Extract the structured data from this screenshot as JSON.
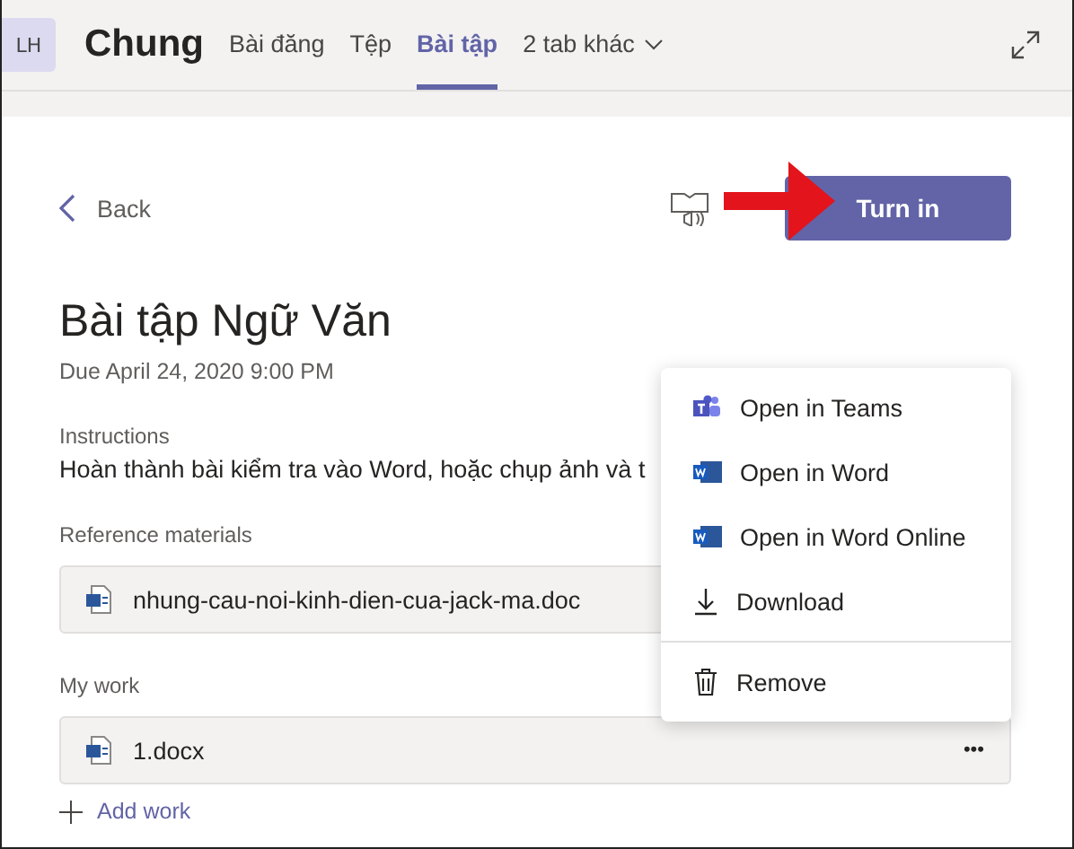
{
  "header": {
    "avatar": "LH",
    "title": "Chung",
    "tabs": [
      {
        "label": "Bài đăng",
        "selected": false,
        "kind": "tab"
      },
      {
        "label": "Tệp",
        "selected": false,
        "kind": "tab"
      },
      {
        "label": "Bài tập",
        "selected": true,
        "kind": "tab"
      },
      {
        "label": "2 tab khác",
        "selected": false,
        "kind": "more"
      }
    ]
  },
  "back": "Back",
  "turn_in": "Turn in",
  "assignment": {
    "title": "Bài tập Ngữ Văn",
    "due": "Due April 24, 2020 9:00 PM",
    "instructions_label": "Instructions",
    "instructions": "Hoàn thành bài kiểm tra vào Word, hoặc chụp ảnh và t",
    "reference_label": "Reference materials",
    "reference_files": [
      "nhung-cau-noi-kinh-dien-cua-jack-ma.doc"
    ],
    "my_work_label": "My work",
    "my_work_files": [
      "1.docx"
    ],
    "more": "•••",
    "add_work": "Add work"
  },
  "menu": [
    {
      "kind": "teams",
      "label": "Open in Teams"
    },
    {
      "kind": "word",
      "label": "Open in Word"
    },
    {
      "kind": "word",
      "label": "Open in Word Online"
    },
    {
      "kind": "download",
      "label": "Download"
    },
    {
      "kind": "remove",
      "label": "Remove"
    }
  ]
}
